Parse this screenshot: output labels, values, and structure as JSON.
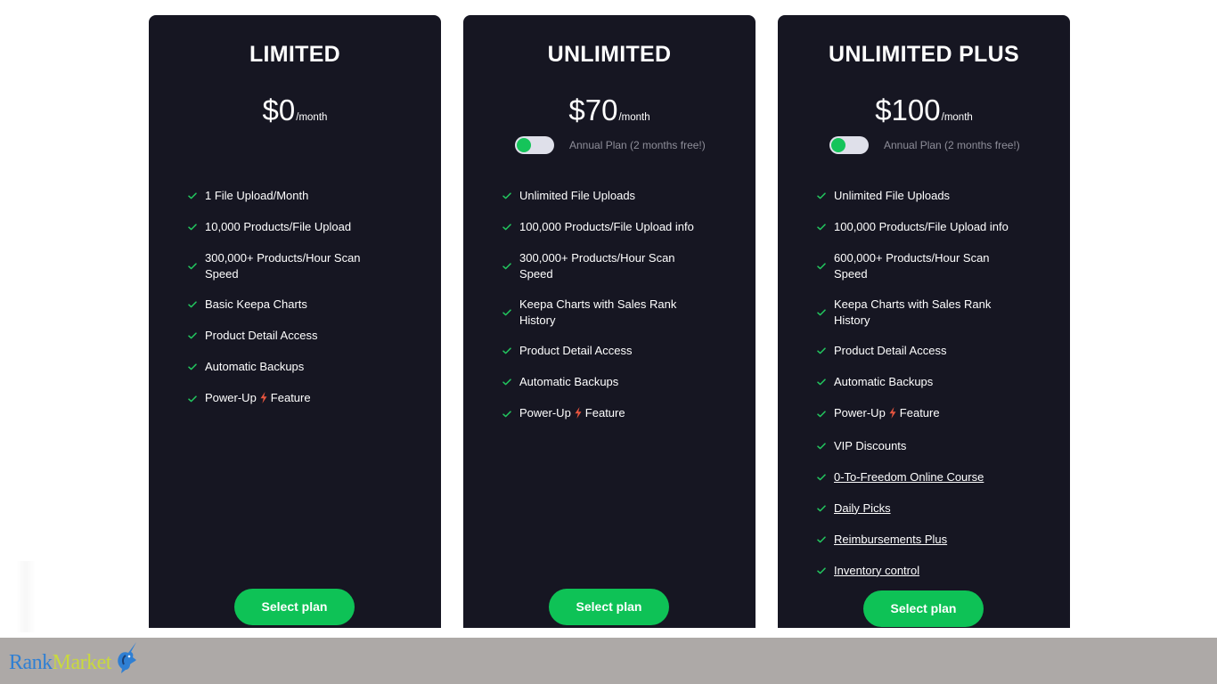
{
  "plans": [
    {
      "title": "LIMITED",
      "price": "$0",
      "per": "/month",
      "features": [
        {
          "text": "1 File Upload/Month"
        },
        {
          "text": "10,000 Products/File Upload"
        },
        {
          "text": "300,000+ Products/Hour Scan Speed"
        },
        {
          "text": "Basic Keepa Charts"
        },
        {
          "text": "Product Detail Access"
        },
        {
          "text": "Automatic Backups"
        },
        {
          "pre": "Power-Up",
          "post": "Feature"
        }
      ],
      "button": "Select plan"
    },
    {
      "title": "UNLIMITED",
      "price": "$70",
      "per": "/month",
      "toggle_label": "Annual Plan (2 months free!)",
      "toggle_on": true,
      "features": [
        {
          "text": "Unlimited File Uploads"
        },
        {
          "text": "100,000 Products/File Upload info"
        },
        {
          "text": "300,000+ Products/Hour Scan Speed"
        },
        {
          "text": "Keepa Charts with Sales Rank History"
        },
        {
          "text": "Product Detail Access"
        },
        {
          "text": "Automatic Backups"
        },
        {
          "pre": "Power-Up",
          "post": "Feature"
        }
      ],
      "button": "Select plan"
    },
    {
      "title": "UNLIMITED PLUS",
      "price": "$100",
      "per": "/month",
      "toggle_label": "Annual Plan (2 months free!)",
      "toggle_on": true,
      "features": [
        {
          "text": "Unlimited File Uploads"
        },
        {
          "text": "100,000 Products/File Upload info"
        },
        {
          "text": "600,000+ Products/Hour Scan Speed"
        },
        {
          "text": "Keepa Charts with Sales Rank History"
        },
        {
          "text": "Product Detail Access"
        },
        {
          "text": "Automatic Backups"
        },
        {
          "pre": "Power-Up",
          "post": "Feature"
        },
        {
          "text": "VIP Discounts"
        },
        {
          "text": "0-To-Freedom Online Course",
          "link": true
        },
        {
          "text": "Daily Picks",
          "link": true
        },
        {
          "text": "Reimbursements Plus",
          "link": true
        },
        {
          "text": "Inventory control",
          "link": true
        }
      ],
      "button": "Select plan"
    }
  ],
  "footer": {
    "logo_part1": "Rank",
    "logo_part2": "Market"
  },
  "colors": {
    "card_bg": "#161622",
    "accent_green": "#0ec256",
    "check_green": "#22c55e",
    "bolt_red": "#e8553f",
    "footer_bg": "#ada9a7",
    "logo_blue": "#2f7fd3",
    "logo_yellow": "#c9d93e"
  },
  "icons": {
    "check": "check-icon",
    "bolt": "lightning-bolt-icon",
    "logo_mark": "unicorn-logo-icon"
  }
}
